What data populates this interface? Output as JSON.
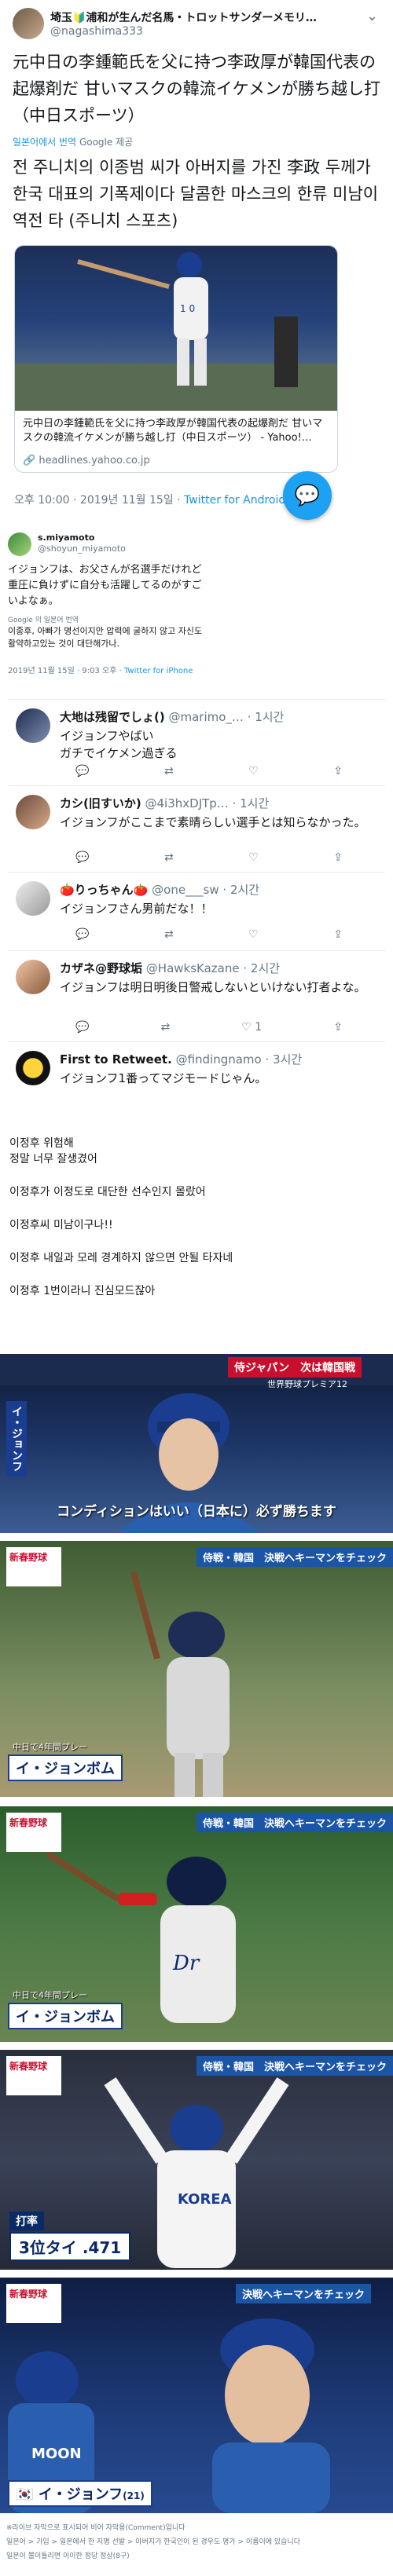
{
  "tweet": {
    "author_name": "埼玉🔰浦和が生んだ名馬・トロットサンダーメモリ…",
    "author_handle": "@nagashima333",
    "text_jp": "元中日の李鍾範氏を父に持つ李政厚が韓国代表の起爆剤だ 甘いマスクの韓流イケメンが勝ち越し打（中日スポーツ）",
    "translated_from": "일본어에서 번역",
    "google_label": "Google 제공",
    "text_kr": "전 주니치의 이종범 씨가 아버지를 가진 李政 두께가 한국 대표의 기폭제이다 달콤한 마스크의 한류 미남이 역전 타 (주니치 스포츠)",
    "card_text": "元中日の李鍾範氏を父に持つ李政厚が韓国代表の起爆剤だ 甘いマスクの韓流イケメンが勝ち越し打（中日スポーツ） - Yahoo!…",
    "card_domain": "headlines.yahoo.co.jp",
    "time": "오후 10:00 · 2019년 11월 15일 · ",
    "client": "Twitter for Android",
    "colors": {
      "accent": "#1b95e0",
      "fab": "#1da1f2"
    }
  },
  "tweet2": {
    "author_name": "s.miyamoto",
    "author_handle": "@shoyun_miyamoto",
    "text_jp": "イジョンフは、お父さんが名選手だけれど重圧に負けずに自分も活躍してるのがすごいよなぁ。",
    "translated_label": "Google 의 일본어 번역",
    "text_kr": "이종후, 아빠가 명선이지만 압력에 굴하지 않고 자신도 활약하고있는 것이 대단해가나.",
    "time": "2019년 11월 15일 · 9:03 오후 · ",
    "client": "Twitter for iPhone"
  },
  "replies": [
    {
      "name": "大地は残留でしょ()",
      "handle": "@marimo_…",
      "time": "· 1시간",
      "text": "イジョンフやばい\nガチでイケメン過ぎる",
      "likes": ""
    },
    {
      "name": "カシ(旧すいか)",
      "handle": "@4i3hxDJTp…",
      "time": "· 1시간",
      "text": "イジョンフがここまで素晴らしい選手とは知らなかった。",
      "likes": ""
    },
    {
      "name": "🍅りっちゃん🍅",
      "handle": "@one___sw",
      "time": "· 2시간",
      "text": "イジョンフさん男前だな！！",
      "likes": ""
    },
    {
      "name": "カザネ@野球垢",
      "handle": "@HawksKazane",
      "time": "· 2시간",
      "text": "イジョンフは明日明後日警戒しないといけない打者よな。",
      "likes": "1"
    },
    {
      "name": "First to Retweet.",
      "handle": "@findingnamo",
      "time": "· 3시간",
      "text": "イジョンフ1番ってマジモードじゃん。",
      "likes": ""
    }
  ],
  "comments": [
    "이정후 위험해\n정말 너무 잘생겼어",
    "이정후가 이정도로 대단한 선수인지 몰랐어",
    "이정후씨 미남이구나!!",
    "이정후 내일과 모레 경계하지 않으면 안될 타자네",
    "이정후 1번이라니 진심모드잖아"
  ],
  "photos": {
    "p1_ticker": "侍ジャパン　次は韓国戦",
    "p1_badge": "世界野球プレミア12",
    "p1_vertical": "イ・ジョンフ",
    "p1_caption": "コンディションはいい（日本に）必ず勝ちます",
    "p2_logo": "新春野球",
    "p2_ticker": "侍戦・韓国　決戦へキーマンをチェック",
    "p2_small": "中日で4年間プレー",
    "p2_name": "イ・ジョンボム",
    "p3_logo": "新春野球",
    "p3_ticker": "侍戦・韓国　決戦へキーマンをチェック",
    "p3_small": "中日で4年間プレー",
    "p3_name": "イ・ジョンボム",
    "p4_logo": "新春野球",
    "p4_ticker": "侍戦・韓国　決戦へキーマンをチェック",
    "p4_stat_label": "打率",
    "p4_stat": "3位タイ .471",
    "p5_logo": "新春野球",
    "p5_ticker": "決戦へキーマンをチェック",
    "p5_name": "イ・ジョンフ",
    "p5_age": "(21)",
    "jersey_korea": "KOREA",
    "jersey_moon": "MOON"
  },
  "footer": {
    "line1": "※라이브 자막으로 표시되어 비어 자막용(Comment)입니다",
    "line2": "일본어 > 가입 > 일본에서 한 지명 선발 > 아버지가 한국인이 된 경우도 명가 > 이름이에 있습니다",
    "line3": "일본이 불이틀리면 이이한 정당 정상(8구)"
  }
}
